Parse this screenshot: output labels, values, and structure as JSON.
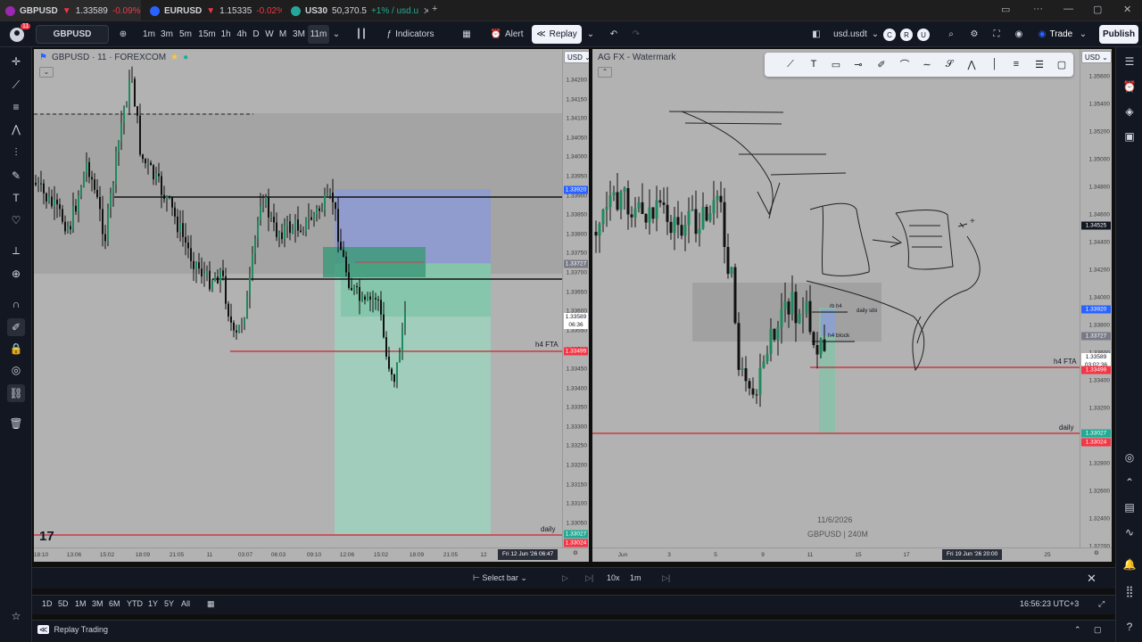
{
  "tabs": [
    {
      "symbol": "GBPUSD",
      "arrow": "▼",
      "price": "1.33589",
      "change": "-0.09% /",
      "icon_color": "#9c27b0",
      "active": true
    },
    {
      "symbol": "EURUSD",
      "arrow": "▼",
      "price": "1.15335",
      "change": "-0.02% /",
      "icon_color": "#2962ff",
      "active": false
    },
    {
      "symbol": "US30",
      "arrow": "",
      "price": "50,370.5",
      "change": "+1% / usd.u",
      "icon_color": "#26a69a",
      "active": false
    }
  ],
  "topbar": {
    "symbol": "GBPUSD",
    "intervals": [
      "1m",
      "3m",
      "5m",
      "15m",
      "1h",
      "4h",
      "D",
      "W",
      "M",
      "3M",
      "11m"
    ],
    "active_interval": "11m",
    "indicators_label": "Indicators",
    "alert_label": "Alert",
    "replay_label": "Replay",
    "account_label": "usd.usdt",
    "account_badges": [
      "C",
      "R",
      "U"
    ],
    "trade_label": "Trade",
    "publish_label": "Publish",
    "notification_count": "11"
  },
  "left_chart": {
    "title": "GBPUSD · 11 · FOREXCOM",
    "currency": "USD",
    "price_labels": [
      "1.34200",
      "1.34150",
      "1.34100",
      "1.34050",
      "1.34000",
      "1.33950",
      "1.33900",
      "1.33850",
      "1.33800",
      "1.33750",
      "1.33700",
      "1.33650",
      "1.33600",
      "1.33550",
      "1.33500",
      "1.33450",
      "1.33400",
      "1.33350",
      "1.33300",
      "1.33250",
      "1.33200",
      "1.33150",
      "1.33100",
      "1.33050",
      "1.33000"
    ],
    "tags": [
      {
        "text": "1.33920",
        "color": "#2962ff"
      },
      {
        "text": "1.33727",
        "color": "#787b86"
      },
      {
        "text": "1.33589",
        "color": "#ffffff",
        "text_color": "#131722",
        "sub": "06:36"
      },
      {
        "text": "1.33499",
        "color": "#f23645"
      },
      {
        "text": "1.33027",
        "color": "#22ab94"
      },
      {
        "text": "1.33024",
        "color": "#f23645"
      }
    ],
    "time_labels": [
      "18:10",
      "13:06",
      "15:02",
      "18:09",
      "21:05",
      "11",
      "03:07",
      "06:03",
      "09:10",
      "12:06",
      "15:02",
      "18:09",
      "21:05",
      "12"
    ],
    "crosshair_time": "Fri 12 Jun '26  06:47",
    "labels": {
      "h4fta": "h4 FTA",
      "daily": "daily"
    }
  },
  "right_chart": {
    "title": "AG FX - Watermark",
    "currency": "USD",
    "price_labels": [
      "1.35600",
      "1.35400",
      "1.35200",
      "1.35000",
      "1.34800",
      "1.34600",
      "1.34400",
      "1.34200",
      "1.34000",
      "1.33800",
      "1.33600",
      "1.33400",
      "1.33200",
      "1.33000",
      "1.32800",
      "1.32600",
      "1.32400",
      "1.32200"
    ],
    "tags": [
      {
        "text": "1.34525",
        "color": "#131722"
      },
      {
        "text": "1.33920",
        "color": "#2962ff"
      },
      {
        "text": "1.33727",
        "color": "#787b86"
      },
      {
        "text": "1.33589",
        "color": "#ffffff",
        "text_color": "#131722",
        "sub": "03:02:36"
      },
      {
        "text": "1.33499",
        "color": "#f23645"
      },
      {
        "text": "1.33027",
        "color": "#22ab94"
      },
      {
        "text": "1.33024",
        "color": "#f23645"
      }
    ],
    "time_labels": [
      "Jun",
      "3",
      "5",
      "9",
      "11",
      "15",
      "17",
      "25"
    ],
    "crosshair_time": "Fri 19 Jun '26  20:00",
    "watermark_date": "11/6/2026",
    "watermark_sym": "GBPUSD | 240M",
    "labels": {
      "rbh4": "rb h4",
      "daily_sibi": "daily sibi",
      "h4block": "h4 block",
      "h4fta": "h4 FTA",
      "daily": "daily"
    }
  },
  "replay": {
    "select_bar_label": "Select bar",
    "speed": "10x",
    "interval": "1m"
  },
  "ranges": [
    "1D",
    "5D",
    "1M",
    "3M",
    "6M",
    "YTD",
    "1Y",
    "5Y",
    "All"
  ],
  "clock": "16:56:23 UTC+3",
  "status": {
    "label": "Replay Trading"
  },
  "colors": {
    "bg": "#131722",
    "chart_bg": "#b2b2b2",
    "blue": "#2962ff",
    "red": "#f23645",
    "green": "#22ab94"
  }
}
